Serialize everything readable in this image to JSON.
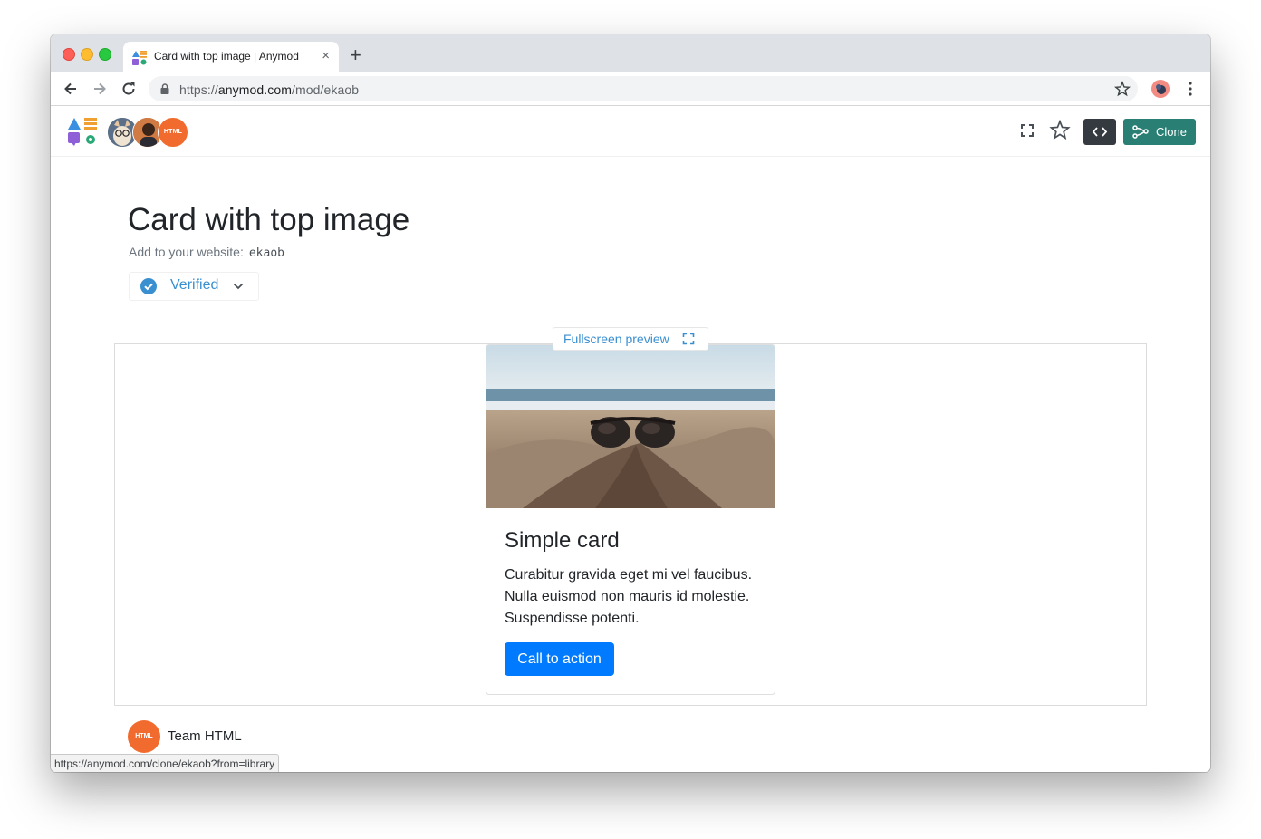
{
  "browser": {
    "tab_title": "Card with top image | Anymod",
    "new_tab_symbol": "+",
    "close_symbol": "×",
    "url_scheme": "https://",
    "url_host": "anymod.com",
    "url_path": "/mod/ekaob",
    "status_url": "https://anymod.com/clone/ekaob?from=library"
  },
  "appbar": {
    "avatar_html_label": "HTML",
    "clone_label": "Clone",
    "icons": [
      "anymod-logo-icon",
      "fullscreen-icon",
      "star-icon",
      "code-icon",
      "clone-icon"
    ]
  },
  "mod": {
    "title": "Card with top image",
    "embed_label": "Add to your website:",
    "embed_code": "ekaob",
    "verified_label": "Verified",
    "fullscreen_label": "Fullscreen preview"
  },
  "card": {
    "title": "Simple card",
    "text": "Curabitur gravida eget mi vel faucibus. Nulla euismod non mauris id molestie. Suspendisse potenti.",
    "cta_label": "Call to action"
  },
  "team": {
    "avatar_label": "HTML",
    "name": "Team HTML"
  },
  "colors": {
    "primary_button": "#007bff",
    "clone_button": "#2a7f74",
    "code_button": "#343a40",
    "link_blue": "#3a8fd0",
    "html_orange": "#f26b2e"
  }
}
